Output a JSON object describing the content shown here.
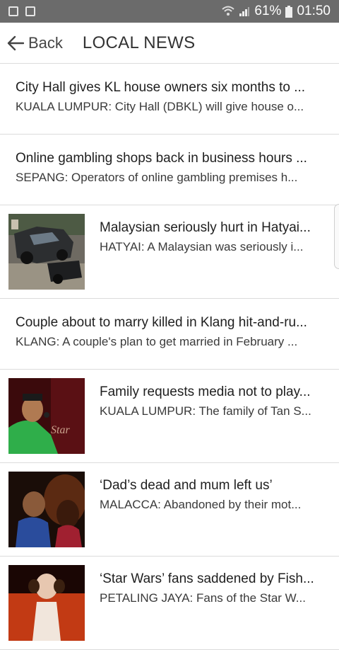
{
  "status_bar": {
    "battery": "61%",
    "time": "01:50"
  },
  "header": {
    "back_label": "Back",
    "title": "LOCAL NEWS"
  },
  "articles": [
    {
      "headline": "City Hall gives KL house owners six months to ...",
      "summary": "KUALA LUMPUR: City Hall (DBKL) will give house o...",
      "has_image": false
    },
    {
      "headline": "Online gambling shops back in business hours ...",
      "summary": "SEPANG: Operators of online gambling premises h...",
      "has_image": false
    },
    {
      "headline": "Malaysian seriously hurt in Hatyai...",
      "summary": "HATYAI: A Malaysian was seriously i...",
      "has_image": true,
      "image": "car-wreck-photo"
    },
    {
      "headline": "Couple about to marry killed in Klang hit-and-ru...",
      "summary": "KLANG: A couple's plan to get married in February ...",
      "has_image": false
    },
    {
      "headline": "Family requests media not to play...",
      "summary": "KUALA LUMPUR: The family of Tan S...",
      "has_image": true,
      "image": "singer-photo",
      "image_watermark": "Star"
    },
    {
      "headline": "‘Dad’s dead and mum left us’",
      "summary": "MALACCA: Abandoned by their mot...",
      "has_image": true,
      "image": "children-photo"
    },
    {
      "headline": "‘Star Wars’ fans saddened by Fish...",
      "summary": "PETALING JAYA: Fans of the Star W...",
      "has_image": true,
      "image": "star-wars-photo"
    }
  ]
}
